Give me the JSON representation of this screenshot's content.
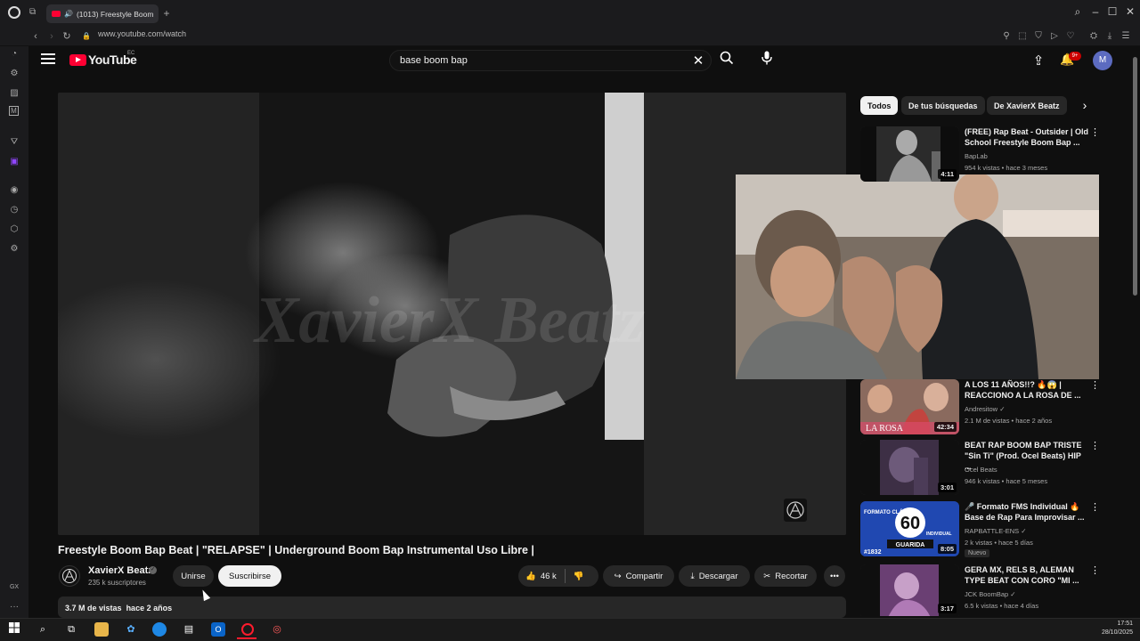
{
  "browser": {
    "tab_title": "(1013) Freestyle Boom",
    "new_tab": "+",
    "url": "www.youtube.com/watch",
    "sidebar_icons": [
      "opera-logo-icon",
      "tab-islands-icon",
      "history-icon",
      "messenger-icon",
      "whatsapp-icon",
      "twitter-icon",
      "twitch-icon",
      "spotify-icon",
      "clock-icon",
      "extensions-icon",
      "settings-icon"
    ],
    "gx_label": "GX",
    "more_label": "···"
  },
  "youtube": {
    "logo_text": "YouTube",
    "logo_region": "EC",
    "search_value": "base boom bap",
    "notif_count": "9+",
    "avatar_letter": "M"
  },
  "video": {
    "watermark_text": "XavierX Beatz",
    "title": "Freestyle Boom Bap Beat | \"RELAPSE\" | Underground Boom Bap Instrumental Uso Libre |",
    "channel": "XavierX Beatz",
    "subscribers": "235 k suscriptores",
    "join_label": "Unirse",
    "subscribe_label": "Suscribirse",
    "likes": "46 k",
    "share_label": "Compartir",
    "download_label": "Descargar",
    "clip_label": "Recortar",
    "views": "3.7 M de vistas",
    "age": "hace 2 años"
  },
  "chips": [
    {
      "label": "Todos",
      "active": true
    },
    {
      "label": "De tus búsquedas",
      "active": false
    },
    {
      "label": "De XavierX Beatz",
      "active": false
    }
  ],
  "recommendations": [
    {
      "title": "(FREE) Rap Beat - Outsider | Old School Freestyle Boom Bap ...",
      "channel": "BapLab",
      "meta": "954 k vistas • hace 3 meses",
      "duration": "4:11",
      "verified": false,
      "new": false
    },
    {
      "title": "A LOS 11 AÑOS!!? 🔥😱 | REACCIONO A LA ROSA DE ...",
      "channel": "Andresitow",
      "meta": "2.1 M de vistas • hace 2 años",
      "duration": "42:34",
      "verified": true,
      "new": false
    },
    {
      "title": "BEAT RAP BOOM BAP TRISTE \"Sin Ti\" (Prod. Ocel Beats) HIP ...",
      "channel": "Ocel Beats",
      "meta": "946 k vistas • hace 5 meses",
      "duration": "3:01",
      "verified": false,
      "new": false
    },
    {
      "title": "🎤 Formato FMS Individual 🔥 Base de Rap Para Improvisar ...",
      "channel": "RAPBATTLE-ENS",
      "meta": "2 k vistas • hace 5 días",
      "duration": "8:05",
      "verified": true,
      "new": true,
      "new_label": "Nuevo"
    },
    {
      "title": "GERA MX, RELS B, ALEMAN TYPE BEAT CON CORO \"MI ...",
      "channel": "JCK BoomBap",
      "meta": "6.5 k vistas • hace 4 días",
      "duration": "3:17",
      "verified": true,
      "new": false
    }
  ],
  "thumb_texts": {
    "fms_number": "60",
    "fms_formato": "FORMATO CLÁSICO",
    "fms_individual": "INDIVIDUAL",
    "fms_guarida": "GUARIDA",
    "fms_tag": "#1832",
    "rosa_text": "LA ROSA"
  },
  "taskbar": {
    "time": "17:51",
    "date": "28/10/2025"
  },
  "colors": {
    "yt_red": "#ff0033",
    "bg": "#0f0f0f",
    "chip_bg": "#272727",
    "opera_red": "#ff1b2d"
  }
}
